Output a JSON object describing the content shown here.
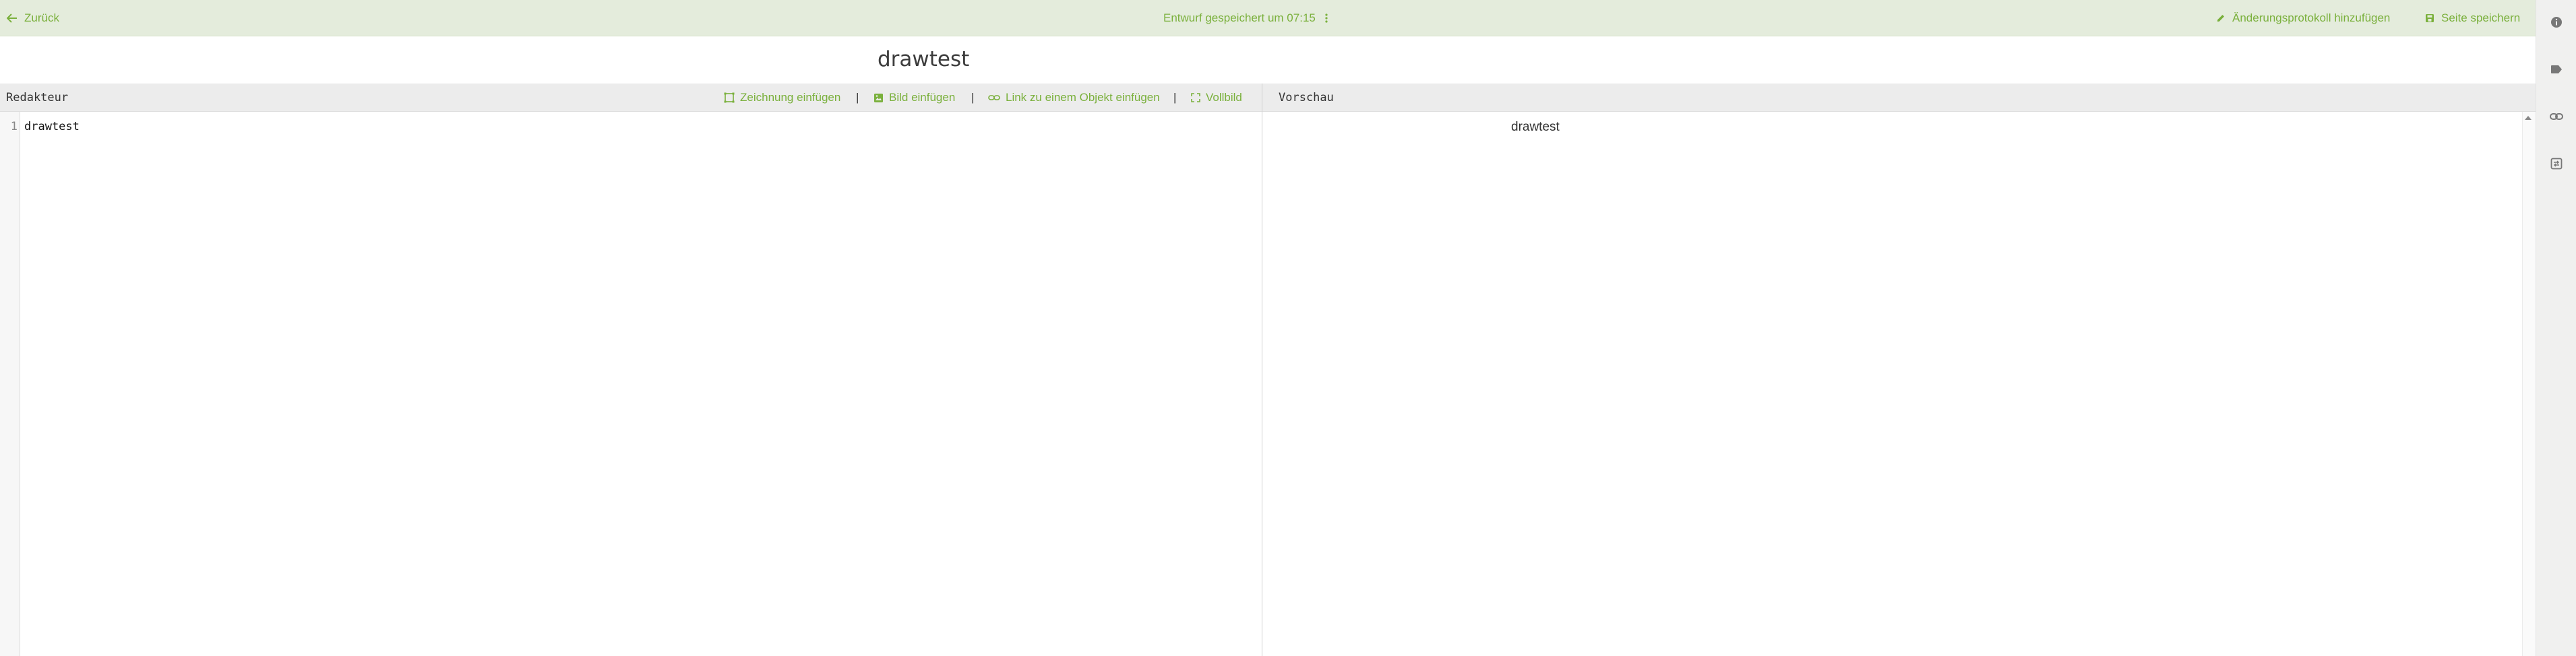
{
  "topbar": {
    "back_label": "Zurück",
    "draft_status": "Entwurf gespeichert um 07:15",
    "add_changelog_label": "Änderungsprotokoll hinzufügen",
    "save_label": "Seite speichern"
  },
  "page": {
    "title": "drawtest"
  },
  "editor": {
    "label": "Redakteur",
    "toolbar": {
      "insert_drawing": "Zeichnung einfügen",
      "insert_image": "Bild einfügen",
      "insert_link": "Link zu einem Objekt einfügen",
      "fullscreen": "Vollbild",
      "separator": "|"
    },
    "line_numbers": [
      "1"
    ],
    "lines": [
      "drawtest"
    ]
  },
  "preview": {
    "label": "Vorschau",
    "content": "drawtest"
  },
  "side_rail": {
    "icons": [
      "info-icon",
      "tag-icon",
      "link-icon",
      "toggle-icon"
    ]
  },
  "colors": {
    "accent": "#7ab03c",
    "topbar_bg": "#e4ecdc",
    "pane_header_bg": "#ececec"
  }
}
